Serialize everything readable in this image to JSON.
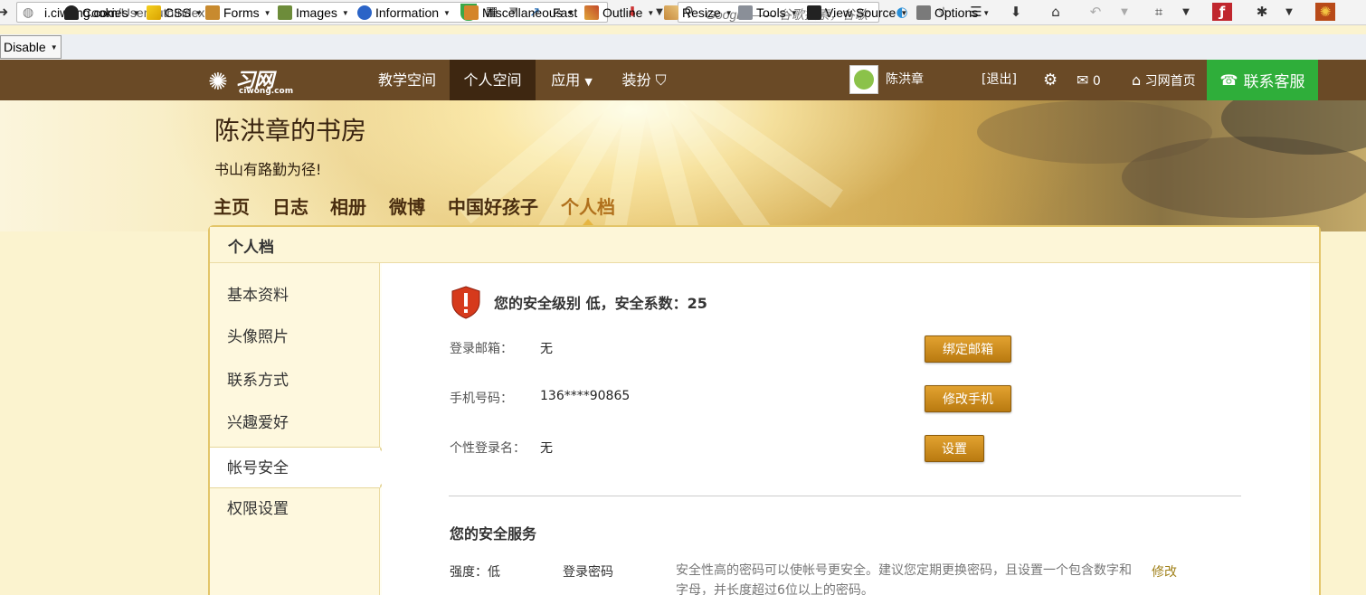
{
  "browser": {
    "url_host": "i.ciwong.com",
    "url_path": "/UserAuthIndex",
    "fast_label": "Fast",
    "search_engine": "Google",
    "search_placeholder": "—— 谷歌搜索，谷歌"
  },
  "devtoolbar": {
    "items": [
      "Disable",
      "Cookies",
      "CSS",
      "Forms",
      "Images",
      "Information",
      "Miscellaneous",
      "Outline",
      "Resize",
      "Tools",
      "View Source",
      "Options"
    ]
  },
  "header": {
    "logo_cn": "习网",
    "logo_en": "ciwong.com",
    "nav": [
      "教学空间",
      "个人空间",
      "应用",
      "装扮"
    ],
    "username": "陈洪章",
    "logout": "[退出]",
    "mail_count": "0",
    "home_link": "习网首页",
    "service": "联系客服"
  },
  "space": {
    "title": "陈洪章的书房",
    "motto": "书山有路勤为径!",
    "tabs": [
      "主页",
      "日志",
      "相册",
      "微博",
      "中国好孩子",
      "个人档"
    ]
  },
  "profile": {
    "box_title": "个人档",
    "sidebar": [
      "基本资料",
      "头像照片",
      "联系方式",
      "兴趣爱好",
      "帐号安全",
      "权限设置"
    ],
    "security_level": "您的安全级别 低，安全系数：25",
    "rows": [
      {
        "label": "登录邮箱：",
        "value": "无",
        "button": "绑定邮箱"
      },
      {
        "label": "手机号码：",
        "value": "136****90865",
        "button": "修改手机"
      },
      {
        "label": "个性登录名：",
        "value": "无",
        "button": "设置"
      }
    ],
    "services_title": "您的安全服务",
    "service": {
      "strength": "强度：低",
      "name": "登录密码",
      "desc": "安全性高的密码可以使帐号更安全。建议您定期更换密码，且设置一个包含数字和字母，并长度超过6位以上的密码。",
      "action": "修改"
    }
  },
  "colors": {
    "header_bg": "#6a4a26",
    "service_green": "#2fae3a",
    "button_gold": "#c98b1e",
    "tab_active": "#b0701c"
  }
}
